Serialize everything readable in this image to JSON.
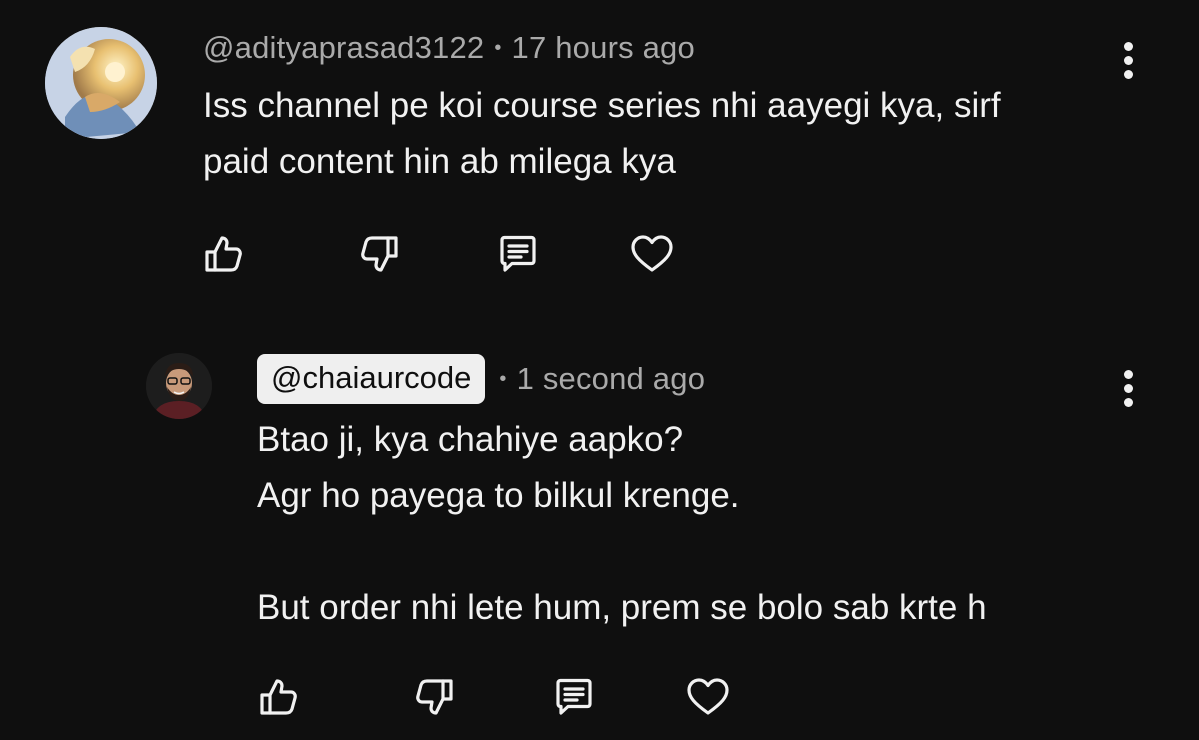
{
  "comment": {
    "author": "@adityaprasad3122",
    "time": "17 hours ago",
    "separator": "•",
    "lines": [
      "Iss channel pe koi course series nhi aayegi kya, sirf",
      "paid content hin ab milega kya"
    ],
    "actions": [
      "like-icon",
      "dislike-icon",
      "reply-icon",
      "heart-icon"
    ]
  },
  "reply": {
    "author": "@chaiaurcode",
    "time": "1 second ago",
    "separator": "•",
    "lines": [
      "Btao ji, kya chahiye aapko?",
      "Agr ho payega to bilkul krenge.",
      "",
      "But order nhi lete hum, prem se bolo sab krte h"
    ],
    "actions": [
      "like-icon",
      "dislike-icon",
      "reply-icon",
      "heart-icon"
    ]
  },
  "colors": {
    "background": "#0f0f0f",
    "text": "#f1f1f1",
    "meta": "#aaaaaa",
    "chip": "#efefef"
  }
}
